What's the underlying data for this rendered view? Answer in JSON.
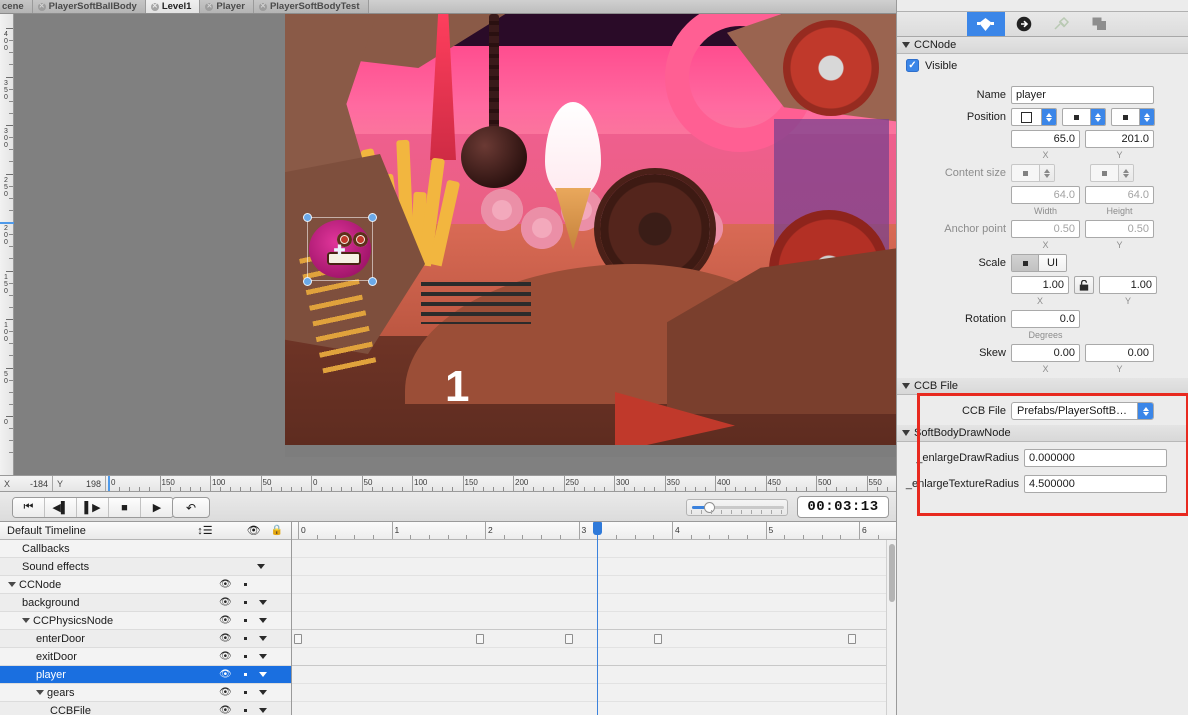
{
  "tabs": [
    {
      "label": "cene",
      "active": false,
      "close_icon": "close-circle-icon"
    },
    {
      "label": "PlayerSoftBallBody",
      "active": false,
      "close_icon": "close-circle-icon"
    },
    {
      "label": "Level1",
      "active": true,
      "close_icon": "close-circle-icon"
    },
    {
      "label": "Player",
      "active": false,
      "close_icon": "close-circle-icon"
    },
    {
      "label": "PlayerSoftBodyTest",
      "active": false,
      "close_icon": "close-circle-icon"
    }
  ],
  "canvas": {
    "stage_number": "1",
    "vertical_ruler_ticks": [
      "400",
      "350",
      "300",
      "250",
      "200",
      "150",
      "100",
      "50",
      "0"
    ],
    "horizontal_ruler_ticks": [
      "0",
      "150",
      "100",
      "50",
      "0",
      "50",
      "100",
      "150",
      "200",
      "250",
      "300",
      "350",
      "400",
      "450",
      "500",
      "550",
      "6"
    ]
  },
  "coordbar": {
    "x_label": "X",
    "x_value": "-184",
    "y_label": "Y",
    "y_value": "198"
  },
  "transport": {
    "buttons": [
      {
        "name": "go-to-start-button",
        "glyph": "⏮"
      },
      {
        "name": "step-back-button",
        "glyph": "⏴"
      },
      {
        "name": "step-forward-button",
        "glyph": "⏵"
      },
      {
        "name": "stop-button",
        "glyph": "■"
      },
      {
        "name": "play-button",
        "glyph": "▶"
      }
    ],
    "loop_button_glyph": "↩",
    "timecode": "00:03:13",
    "zoom_value": 18
  },
  "timeline": {
    "header": {
      "title": "Default Timeline",
      "sort_icon": "sort-list-icon",
      "eye_icon": "eye-icon",
      "lock_icon": "lock-icon"
    },
    "ruler_marks": [
      "0",
      "1",
      "2",
      "3",
      "4",
      "5",
      "6"
    ],
    "playhead_time": 3.2,
    "rows": [
      {
        "label": "Callbacks",
        "indent": 1,
        "expander": false,
        "eye": false,
        "dot": false,
        "caret": false,
        "selected": false
      },
      {
        "label": "Sound effects",
        "indent": 1,
        "expander": false,
        "eye": false,
        "dot": false,
        "caret": true,
        "selected": false
      },
      {
        "label": "CCNode",
        "indent": 0,
        "expander": true,
        "eye": true,
        "dot": true,
        "caret": false,
        "selected": false
      },
      {
        "label": "background",
        "indent": 1,
        "expander": false,
        "eye": true,
        "dot": true,
        "caret": true,
        "selected": false
      },
      {
        "label": "CCPhysicsNode",
        "indent": 1,
        "expander": true,
        "eye": true,
        "dot": true,
        "caret": true,
        "selected": false
      },
      {
        "label": "enterDoor",
        "indent": 2,
        "expander": false,
        "eye": true,
        "dot": true,
        "caret": true,
        "selected": false
      },
      {
        "label": "exitDoor",
        "indent": 2,
        "expander": false,
        "eye": true,
        "dot": true,
        "caret": true,
        "selected": false
      },
      {
        "label": "player",
        "indent": 2,
        "expander": false,
        "eye": true,
        "dot": true,
        "caret": true,
        "selected": true
      },
      {
        "label": "gears",
        "indent": 2,
        "expander": true,
        "eye": true,
        "dot": true,
        "caret": true,
        "selected": false
      },
      {
        "label": "CCBFile",
        "indent": 3,
        "expander": false,
        "eye": true,
        "dot": true,
        "caret": true,
        "selected": false
      }
    ],
    "keyframe_row_index": 5,
    "keyframes": [
      0.0,
      1.95,
      2.9,
      3.85,
      5.93
    ]
  },
  "inspector": {
    "toolbar_icons": [
      {
        "name": "node-properties-icon",
        "glyph": "⬟",
        "active": true
      },
      {
        "name": "animation-icon",
        "glyph": "➡",
        "active": false
      },
      {
        "name": "physics-pin-icon",
        "glyph": "✓",
        "active": false
      },
      {
        "name": "layers-icon",
        "glyph": "▣",
        "active": false
      }
    ],
    "ccnode": {
      "section_title": "CCNode",
      "visible_label": "Visible",
      "visible_checked": true,
      "name_label": "Name",
      "name_value": "player",
      "position_label": "Position",
      "position_x": "65.0",
      "position_y": "201.0",
      "axis_x": "X",
      "axis_y": "Y",
      "content_size_label": "Content size",
      "content_width": "64.0",
      "content_height": "64.0",
      "width_label": "Width",
      "height_label": "Height",
      "anchor_label": "Anchor point",
      "anchor_x": "0.50",
      "anchor_y": "0.50",
      "scale_label": "Scale",
      "scale_unit": "UI",
      "scale_x": "1.00",
      "scale_y": "1.00",
      "scale_locked": true,
      "rotation_label": "Rotation",
      "rotation_value": "0.0",
      "degrees_label": "Degrees",
      "skew_label": "Skew",
      "skew_x": "0.00",
      "skew_y": "0.00"
    },
    "ccbfile": {
      "section_title": "CCB File",
      "field_label": "CCB File",
      "field_value": "Prefabs/PlayerSoftB…"
    },
    "softbody": {
      "section_title": "SoftBodyDrawNode",
      "fields": [
        {
          "label": "_enlargeDrawRadius",
          "value": "0.000000"
        },
        {
          "label": "_enlargeTextureRadius",
          "value": "4.500000"
        }
      ]
    },
    "highlight_color": "#e8291f"
  }
}
